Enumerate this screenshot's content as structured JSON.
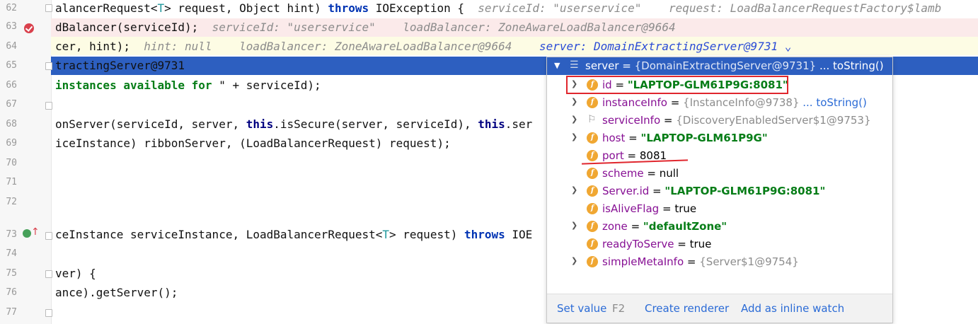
{
  "gutter": {
    "lines": [
      "62",
      "63",
      "64",
      "65",
      "66",
      "67",
      "68",
      "69",
      "70",
      "71",
      "72",
      "73",
      "74",
      "75",
      "76",
      "77"
    ]
  },
  "code": {
    "l62": {
      "t1": "alancerRequest<",
      "gen": "T",
      "t2": "> request, Object hint) ",
      "kw": "throws",
      "t3": " IOException {",
      "hint": "serviceId: \"userservice\"    request: LoadBalancerRequestFactory$lamb"
    },
    "l63": {
      "t1": "dBalancer(serviceId);",
      "hint": "serviceId: \"userservice\"    loadBalancer: ZoneAwareLoadBalancer@9664"
    },
    "l64": {
      "t1": "cer, hint);",
      "hint": "hint: null    loadBalancer: ZoneAwareLoadBalancer@9664",
      "hint2": "server: DomainExtractingServer@9731"
    },
    "l65": {
      "t1": "tractingServer@9731"
    },
    "l66": {
      "str": "instances available for ",
      "t1": "\" + serviceId);"
    },
    "l68": {
      "t1": "onServer(serviceId, server, ",
      "kw": "this",
      "t2": ".isSecure(server, serviceId), ",
      "kw2": "this",
      "t3": ".ser"
    },
    "l69": {
      "t1": "iceInstance) ribbonServer, (LoadBalancerRequest) request);"
    },
    "l73": {
      "t1": "ceInstance serviceInstance, LoadBalancerRequest<",
      "gen": "T",
      "t2": "> request) ",
      "kw": "throws",
      "t3": " IOE"
    },
    "l75": {
      "t1": "ver) {"
    },
    "l76": {
      "t1": "ance).getServer();"
    }
  },
  "popup": {
    "header": {
      "name": "server",
      "eq": " = ",
      "value": "{DomainExtractingServer@9731}",
      "dots": " ... ",
      "link": "toString()"
    },
    "fields": [
      {
        "name": "id",
        "eq": " = ",
        "value": "\"LAPTOP-GLM61P9G:8081\"",
        "kind": "str",
        "expand": true,
        "icon": "field-icon"
      },
      {
        "name": "instanceInfo",
        "eq": " = ",
        "value": "{InstanceInfo@9738}",
        "kind": "obj",
        "extra": " ... toString()",
        "expand": true,
        "icon": "field-icon"
      },
      {
        "name": "serviceInfo",
        "eq": " = ",
        "value": "{DiscoveryEnabledServer$1@9753}",
        "kind": "obj",
        "expand": true,
        "icon": "flag-icon"
      },
      {
        "name": "host",
        "eq": " = ",
        "value": "\"LAPTOP-GLM61P9G\"",
        "kind": "str",
        "expand": true,
        "icon": "field-icon"
      },
      {
        "name": "port",
        "eq": " = ",
        "value": "8081",
        "kind": "plain",
        "expand": false,
        "icon": "field-icon"
      },
      {
        "name": "scheme",
        "eq": " = ",
        "value": "null",
        "kind": "plain",
        "expand": false,
        "icon": "field-icon"
      },
      {
        "name": "Server.id",
        "eq": " = ",
        "value": "\"LAPTOP-GLM61P9G:8081\"",
        "kind": "str",
        "expand": true,
        "icon": "field-icon"
      },
      {
        "name": "isAliveFlag",
        "eq": " = ",
        "value": "true",
        "kind": "plain",
        "expand": false,
        "icon": "field-icon"
      },
      {
        "name": "zone",
        "eq": " = ",
        "value": "\"defaultZone\"",
        "kind": "str",
        "expand": true,
        "icon": "field-icon"
      },
      {
        "name": "readyToServe",
        "eq": " = ",
        "value": "true",
        "kind": "plain",
        "expand": false,
        "icon": "field-icon"
      },
      {
        "name": "simpleMetaInfo",
        "eq": " = ",
        "value": "{Server$1@9754}",
        "kind": "obj",
        "expand": true,
        "icon": "field-icon"
      }
    ],
    "footer": {
      "set_value": "Set value",
      "set_value_key": "F2",
      "create_renderer": "Create renderer",
      "add_watch": "Add as inline watch"
    }
  },
  "colors": {
    "selection": "#2d5fc0",
    "error_line": "#fbeaea",
    "current_line": "#fdfce4",
    "annotation": "#e0262d"
  }
}
